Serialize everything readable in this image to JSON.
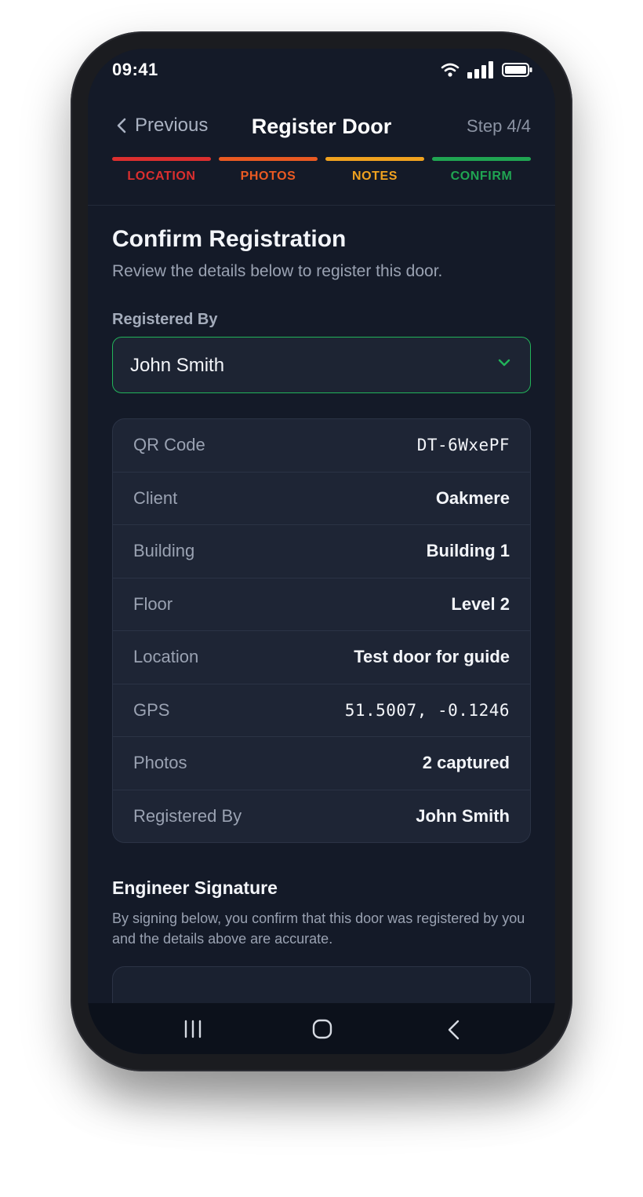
{
  "status_bar": {
    "time": "09:41",
    "icons": [
      "wifi-icon",
      "signal-icon",
      "battery-icon"
    ]
  },
  "header": {
    "back_label": "Previous",
    "title": "Register Door",
    "step": "Step 4/4"
  },
  "stepper": [
    {
      "label": "LOCATION",
      "color": "#dc2f2f"
    },
    {
      "label": "PHOTOS",
      "color": "#ea5a22"
    },
    {
      "label": "NOTES",
      "color": "#f0a21f"
    },
    {
      "label": "CONFIRM",
      "color": "#20a552"
    }
  ],
  "confirm": {
    "title": "Confirm Registration",
    "subtitle": "Review the details below to register this door."
  },
  "registered_by": {
    "label": "Registered By",
    "value": "John Smith"
  },
  "details": [
    {
      "label": "QR Code",
      "value": "DT-6WxePF"
    },
    {
      "label": "Client",
      "value": "Oakmere"
    },
    {
      "label": "Building",
      "value": "Building 1"
    },
    {
      "label": "Floor",
      "value": "Level 2"
    },
    {
      "label": "Location",
      "value": "Test door for guide"
    },
    {
      "label": "GPS",
      "value": "51.5007, -0.1246"
    },
    {
      "label": "Photos",
      "value": "2 captured"
    },
    {
      "label": "Registered By",
      "value": "John Smith"
    }
  ],
  "signature": {
    "title": "Engineer Signature",
    "description": "By signing below, you confirm that this door was registered by you and the details above are accurate."
  },
  "nav_bar": [
    "recents-icon",
    "home-icon",
    "back-icon"
  ],
  "colors": {
    "accent_green": "#22b35a",
    "background": "#141a28",
    "card": "#1e2535"
  }
}
